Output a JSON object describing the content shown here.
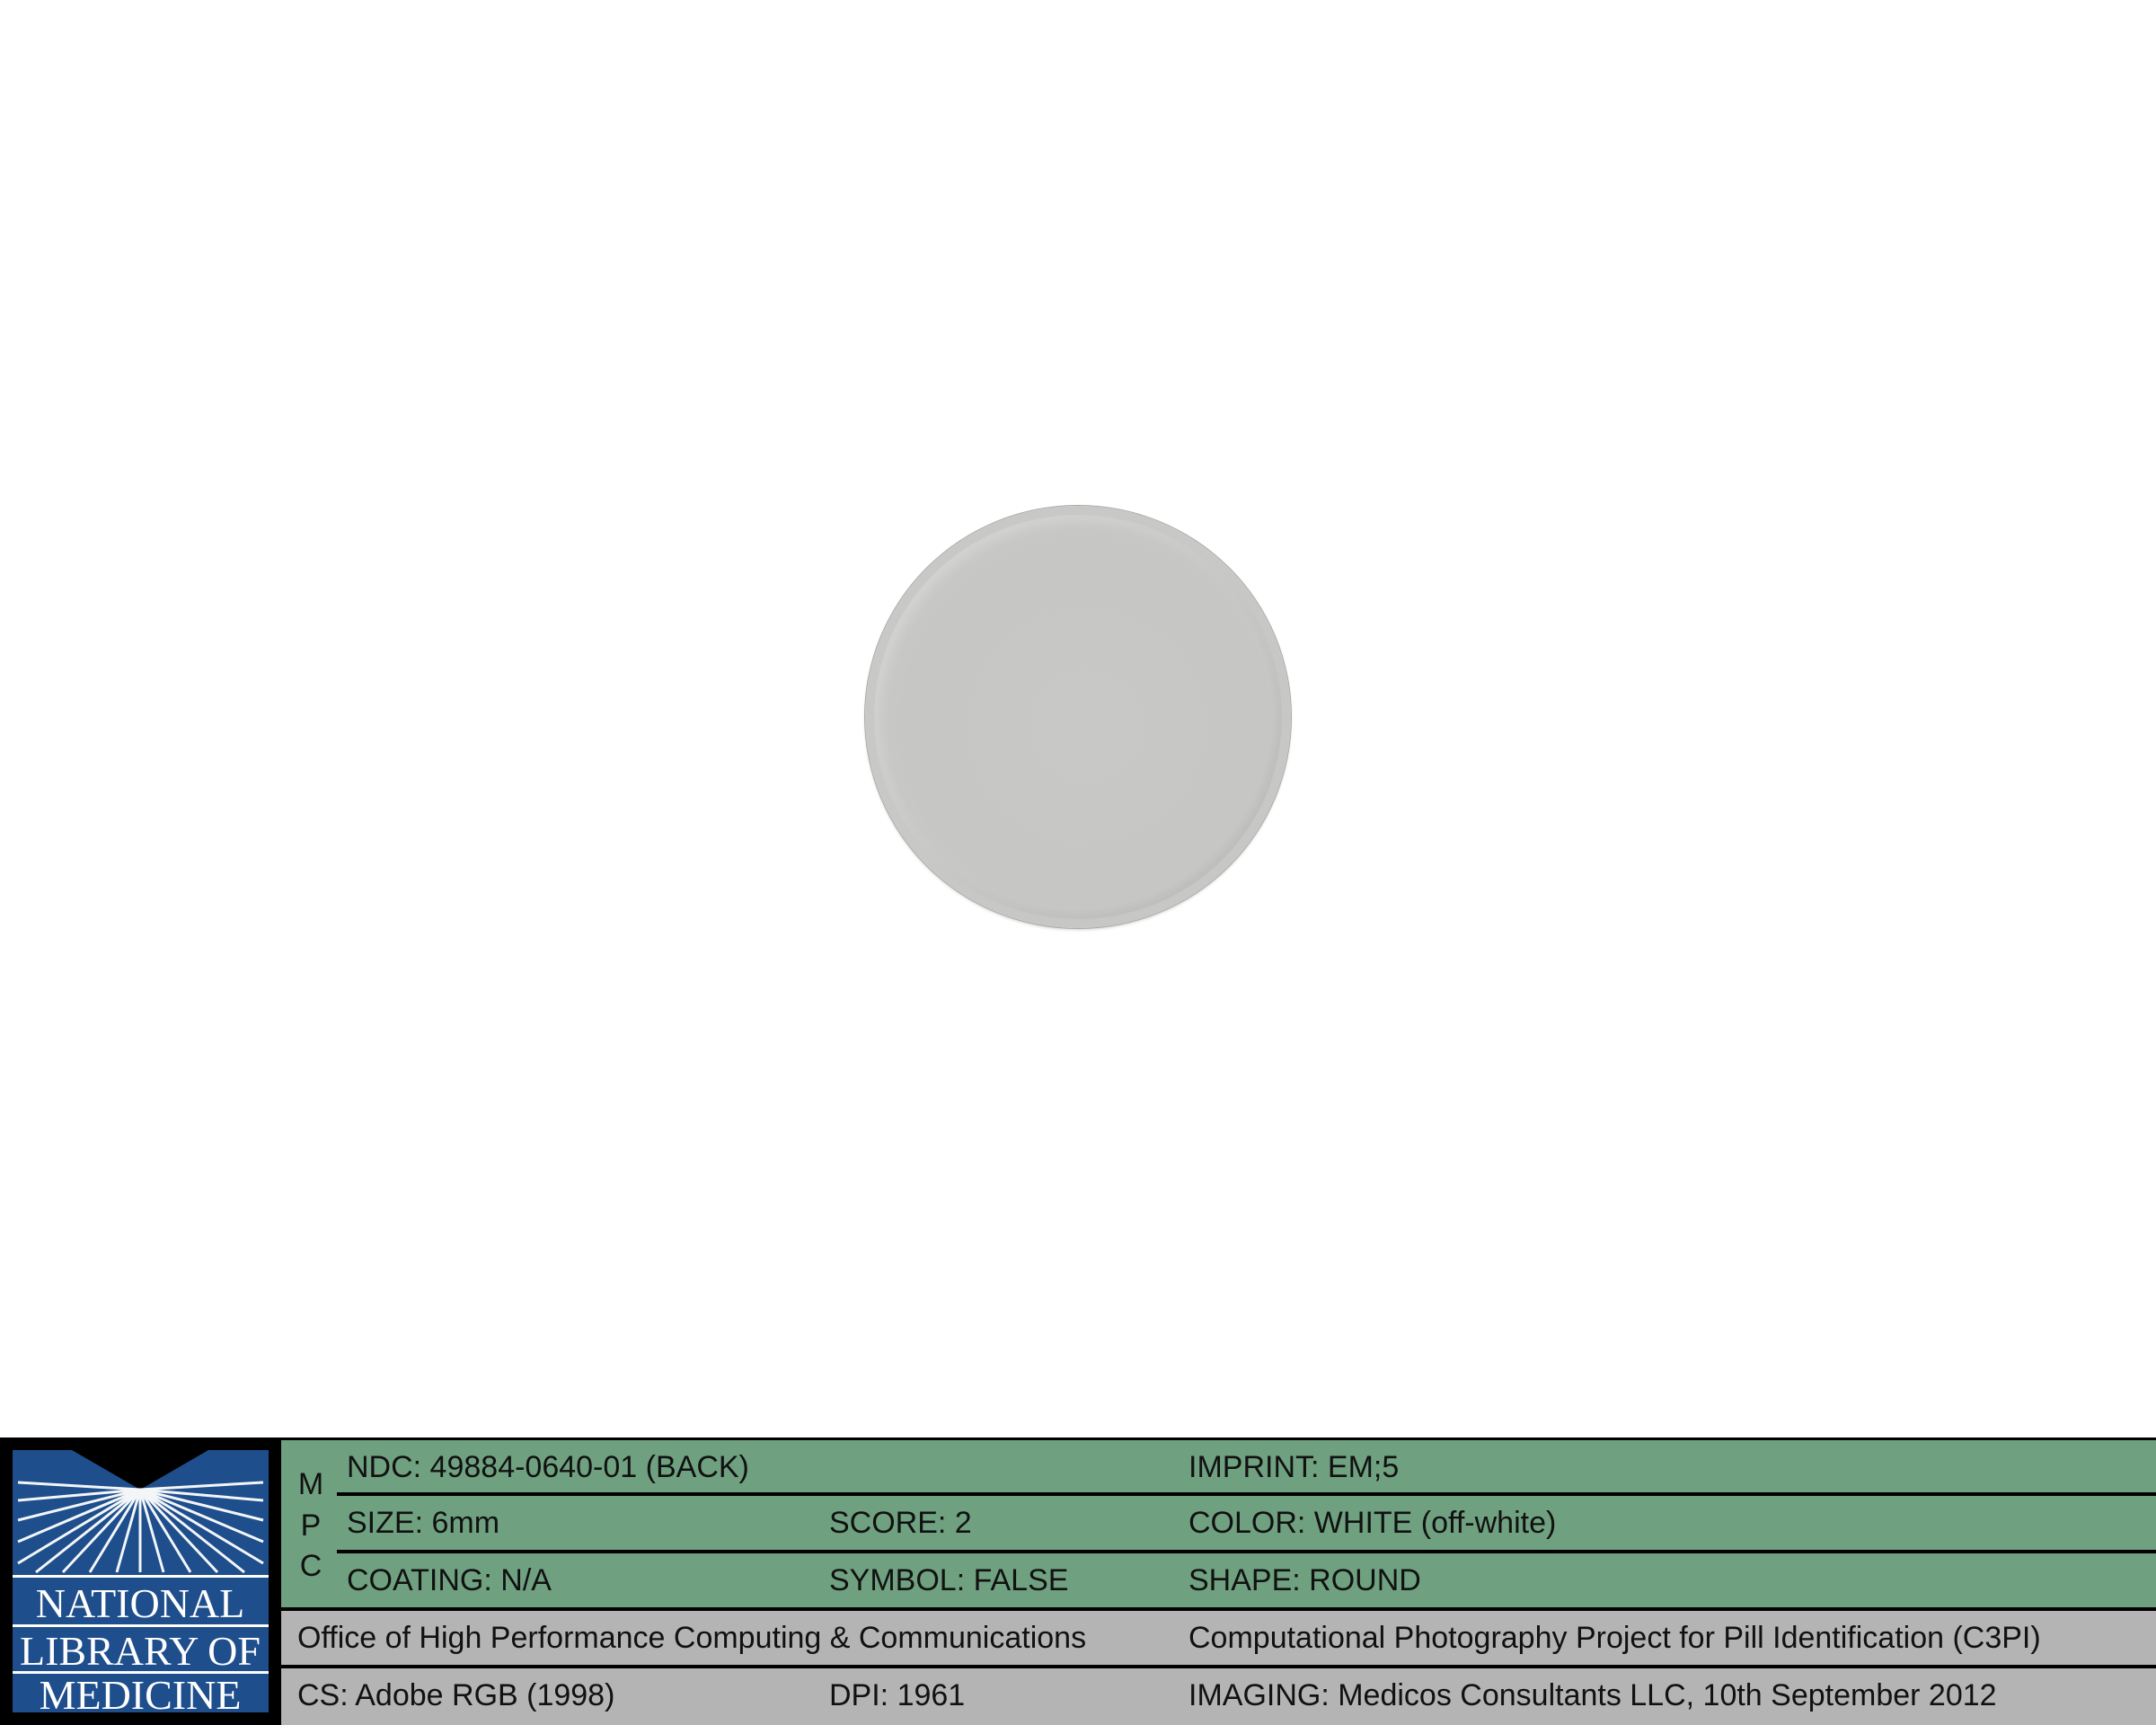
{
  "image": {
    "subject": "pill"
  },
  "logo": {
    "lines": [
      "NATIONAL",
      "LIBRARY OF",
      "MEDICINE"
    ],
    "colors": {
      "blue": "#1e4e8c",
      "text": "#ffffff",
      "frame": "#000000"
    }
  },
  "mpc": {
    "letters": [
      "M",
      "P",
      "C"
    ]
  },
  "info": {
    "ndc": "NDC: 49884-0640-01 (BACK)",
    "imprint": "IMPRINT: EM;5",
    "size": "SIZE: 6mm",
    "score": "SCORE: 2",
    "color": "COLOR: WHITE (off-white)",
    "coating": "COATING: N/A",
    "symbol": "SYMBOL: FALSE",
    "shape": "SHAPE: ROUND",
    "office": "Office of High Performance Computing & Communications",
    "project": "Computational Photography Project for Pill Identification (C3PI)",
    "cs": "CS: Adobe RGB (1998)",
    "dpi": "DPI: 1961",
    "imaging": "IMAGING: Medicos Consultants LLC, 10th September 2012"
  },
  "colors": {
    "green_band": "#6fa181",
    "gray_band": "#b4b4b4",
    "pill": "#c7c7c5"
  }
}
